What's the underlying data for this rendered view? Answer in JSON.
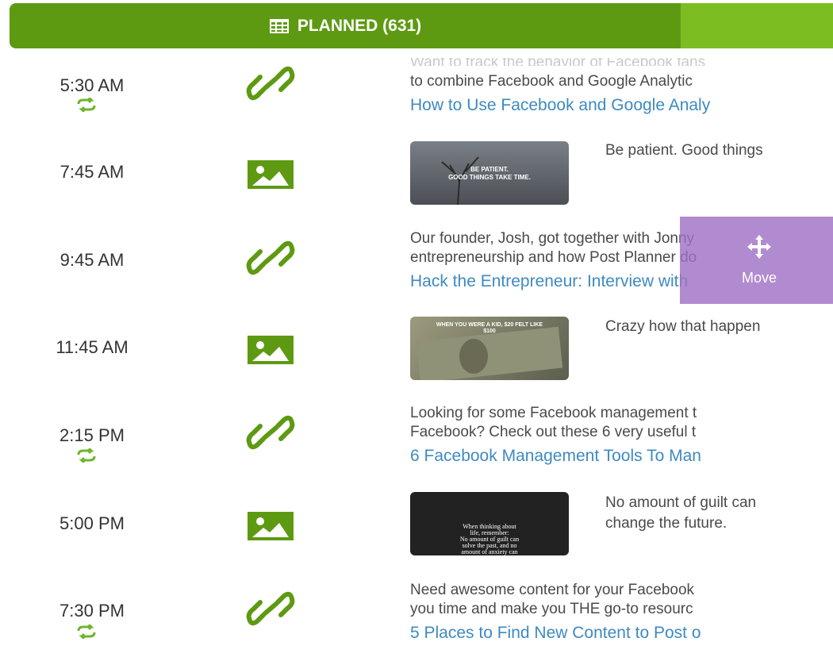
{
  "header": {
    "planned_label": "PLANNED (631)"
  },
  "move_overlay": {
    "label": "Move"
  },
  "colors": {
    "green_dark": "#5d9a12",
    "green_light": "#7cbd22",
    "link_blue": "#3e8ac1",
    "purple": "#a072c4"
  },
  "rows": [
    {
      "time": "5:30 AM",
      "repeat": true,
      "type": "link-icon",
      "faded": "Want to track the behavior of Facebook fans",
      "line1": "to combine Facebook and Google Analytic",
      "link": "How to Use Facebook and Google Analy"
    },
    {
      "time": "7:45 AM",
      "repeat": false,
      "type": "image-icon",
      "thumb_text": "BE PATIENT.\nGOOD THINGS TAKE TIME.",
      "caption": "Be patient. Good things"
    },
    {
      "time": "9:45 AM",
      "repeat": false,
      "type": "link-icon",
      "line1": "Our founder, Josh, got together with Jonny",
      "line2": "entrepreneurship and how Post Planner do",
      "link": "Hack the Entrepreneur: Interview with"
    },
    {
      "time": "11:45 AM",
      "repeat": false,
      "type": "image-icon",
      "thumb_text": "WHEN YOU WERE A KID, $20 FELT LIKE $100",
      "caption": "Crazy how that happen"
    },
    {
      "time": "2:15 PM",
      "repeat": true,
      "type": "link-icon",
      "line1": "Looking for some Facebook management t",
      "line2": "Facebook? Check out these 6 very useful t",
      "link": "6 Facebook Management Tools To Man"
    },
    {
      "time": "5:00 PM",
      "repeat": false,
      "type": "image-icon",
      "thumb_text": "When thinking about life, remember: No amount of guilt can solve the past, and no amount of anxiety can",
      "caption_line1": "No amount of guilt can",
      "caption_line2": "change the future."
    },
    {
      "time": "7:30 PM",
      "repeat": true,
      "type": "link-icon",
      "line1": "Need awesome content for your Facebook",
      "line2": "you time and make you THE go-to resourc",
      "link": "5 Places to Find New Content to Post o"
    }
  ]
}
